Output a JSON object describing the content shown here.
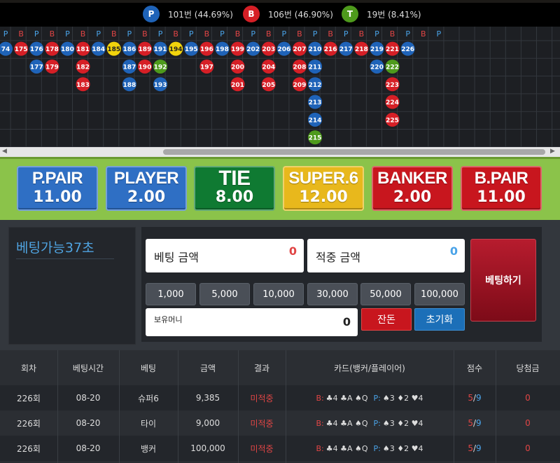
{
  "stats": {
    "player": {
      "letter": "P",
      "text": "101번 (44.69%)",
      "color": "#1f63b8"
    },
    "banker": {
      "letter": "B",
      "text": "106번 (46.90%)",
      "color": "#d61f26"
    },
    "tie": {
      "letter": "T",
      "text": "19번 (8.41%)",
      "color": "#4e9a1c"
    }
  },
  "road": {
    "header": [
      "P",
      "B",
      "P",
      "B",
      "P",
      "B",
      "P",
      "B",
      "P",
      "B",
      "P",
      "B",
      "P",
      "B",
      "P",
      "B",
      "P",
      "B",
      "P",
      "B",
      "P",
      "B",
      "P",
      "B",
      "P",
      "B",
      "P",
      "B",
      "P"
    ],
    "columns": [
      [
        {
          "n": "74",
          "c": "P"
        }
      ],
      [
        {
          "n": "175",
          "c": "B"
        }
      ],
      [
        {
          "n": "176",
          "c": "P"
        },
        {
          "n": "177",
          "c": "P"
        }
      ],
      [
        {
          "n": "178",
          "c": "B"
        },
        {
          "n": "179",
          "c": "B"
        }
      ],
      [
        {
          "n": "180",
          "c": "P"
        }
      ],
      [
        {
          "n": "181",
          "c": "B"
        },
        {
          "n": "182",
          "c": "B"
        },
        {
          "n": "183",
          "c": "B"
        }
      ],
      [
        {
          "n": "184",
          "c": "P"
        }
      ],
      [
        {
          "n": "185",
          "c": "S"
        }
      ],
      [
        {
          "n": "186",
          "c": "P"
        },
        {
          "n": "187",
          "c": "P"
        },
        {
          "n": "188",
          "c": "P"
        }
      ],
      [
        {
          "n": "189",
          "c": "B"
        },
        {
          "n": "190",
          "c": "B"
        }
      ],
      [
        {
          "n": "191",
          "c": "P"
        },
        {
          "n": "192",
          "c": "T"
        },
        {
          "n": "193",
          "c": "P"
        }
      ],
      [
        {
          "n": "194",
          "c": "S"
        }
      ],
      [
        {
          "n": "195",
          "c": "P"
        }
      ],
      [
        {
          "n": "196",
          "c": "B"
        },
        {
          "n": "197",
          "c": "B"
        }
      ],
      [
        {
          "n": "198",
          "c": "P"
        }
      ],
      [
        {
          "n": "199",
          "c": "B"
        },
        {
          "n": "200",
          "c": "B"
        },
        {
          "n": "201",
          "c": "B"
        }
      ],
      [
        {
          "n": "202",
          "c": "P"
        }
      ],
      [
        {
          "n": "203",
          "c": "B"
        },
        {
          "n": "204",
          "c": "B"
        },
        {
          "n": "205",
          "c": "B"
        }
      ],
      [
        {
          "n": "206",
          "c": "P"
        }
      ],
      [
        {
          "n": "207",
          "c": "B"
        },
        {
          "n": "208",
          "c": "B"
        },
        {
          "n": "209",
          "c": "B"
        }
      ],
      [
        {
          "n": "210",
          "c": "P"
        },
        {
          "n": "211",
          "c": "P"
        },
        {
          "n": "212",
          "c": "P"
        },
        {
          "n": "213",
          "c": "P"
        },
        {
          "n": "214",
          "c": "P"
        },
        {
          "n": "215",
          "c": "T"
        }
      ],
      [
        {
          "n": "216",
          "c": "B"
        }
      ],
      [
        {
          "n": "217",
          "c": "P"
        }
      ],
      [
        {
          "n": "218",
          "c": "B"
        }
      ],
      [
        {
          "n": "219",
          "c": "P"
        },
        {
          "n": "220",
          "c": "P"
        }
      ],
      [
        {
          "n": "221",
          "c": "B"
        },
        {
          "n": "222",
          "c": "T"
        },
        {
          "n": "223",
          "c": "B"
        },
        {
          "n": "224",
          "c": "B"
        },
        {
          "n": "225",
          "c": "B"
        }
      ],
      [
        {
          "n": "226",
          "c": "P"
        }
      ]
    ],
    "colors": {
      "P": "#1f63b8",
      "B": "#d61f26",
      "T": "#4e9a1c",
      "S": "#f2d40c"
    }
  },
  "bets": [
    {
      "name": "P.PAIR",
      "odds": "11.00",
      "bg": "#2f6fc4",
      "textColor": "#ffffff"
    },
    {
      "name": "PLAYER",
      "odds": "2.00",
      "bg": "#2f6fc4",
      "textColor": "#ffffff"
    },
    {
      "name": "TIE",
      "odds": "8.00",
      "bg": "#0f7a32",
      "textColor": "#ffffff"
    },
    {
      "name": "SUPER.6",
      "odds": "12.00",
      "bg": "#e8b81c",
      "textColor": "#ffffff"
    },
    {
      "name": "BANKER",
      "odds": "2.00",
      "bg": "#c8161e",
      "textColor": "#ffffff"
    },
    {
      "name": "B.PAIR",
      "odds": "11.00",
      "bg": "#c8161e",
      "textColor": "#ffffff"
    }
  ],
  "panel": {
    "timer": "베팅가능37초",
    "bet_amount_label": "베팅 금액",
    "bet_amount_value": "0",
    "win_amount_label": "적중 금액",
    "win_amount_value": "0",
    "chips": [
      "1,000",
      "5,000",
      "10,000",
      "30,000",
      "50,000",
      "100,000"
    ],
    "balance_label": "보유머니",
    "balance_value": "0",
    "change_label": "잔돈",
    "reset_label": "초기화",
    "place_label": "베팅하기"
  },
  "history": {
    "headers": [
      "회차",
      "베팅시간",
      "베팅",
      "금액",
      "결과",
      "카드(뱅커/플레이어)",
      "점수",
      "당첨금"
    ],
    "rows": [
      {
        "round": "226회",
        "time": "08-20",
        "bet": "슈퍼6",
        "amount": "9,385",
        "result": "미적중",
        "b": "B:",
        "bcards": "♣4 ♣A ♠Q",
        "p": "P:",
        "pcards": "♠3 ♦2 ♥4",
        "score_b": "5",
        "score_p": "9",
        "payout": "0"
      },
      {
        "round": "226회",
        "time": "08-20",
        "bet": "타이",
        "amount": "9,000",
        "result": "미적중",
        "b": "B:",
        "bcards": "♣4 ♣A ♠Q",
        "p": "P:",
        "pcards": "♠3 ♦2 ♥4",
        "score_b": "5",
        "score_p": "9",
        "payout": "0"
      },
      {
        "round": "226회",
        "time": "08-20",
        "bet": "뱅커",
        "amount": "100,000",
        "result": "미적중",
        "b": "B:",
        "bcards": "♣4 ♣A ♠Q",
        "p": "P:",
        "pcards": "♠3 ♦2 ♥4",
        "score_b": "5",
        "score_p": "9",
        "payout": "0"
      }
    ]
  }
}
